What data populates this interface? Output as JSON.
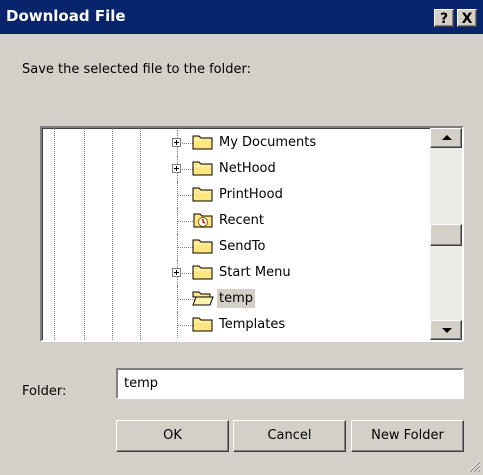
{
  "window": {
    "title": "Download File",
    "help_label": "?",
    "close_label": "X"
  },
  "instruction": "Save the selected file to the folder:",
  "tree": {
    "items": [
      {
        "label": "My Documents",
        "icon": "folder-icon",
        "expandable": true,
        "selected": false
      },
      {
        "label": "NetHood",
        "icon": "folder-icon",
        "expandable": true,
        "selected": false
      },
      {
        "label": "PrintHood",
        "icon": "folder-icon",
        "expandable": false,
        "selected": false
      },
      {
        "label": "Recent",
        "icon": "recent-folder-icon",
        "expandable": false,
        "selected": false
      },
      {
        "label": "SendTo",
        "icon": "folder-icon",
        "expandable": false,
        "selected": false
      },
      {
        "label": "Start Menu",
        "icon": "folder-icon",
        "expandable": true,
        "selected": false
      },
      {
        "label": "temp",
        "icon": "open-folder-icon",
        "expandable": false,
        "selected": true
      },
      {
        "label": "Templates",
        "icon": "folder-icon",
        "expandable": false,
        "selected": false
      }
    ]
  },
  "folder_field": {
    "label": "Folder:",
    "value": "temp"
  },
  "buttons": {
    "ok": "OK",
    "cancel": "Cancel",
    "new_folder": "New Folder"
  },
  "colors": {
    "titlebar": "#08246b",
    "face": "#d4d0c8",
    "folder": "#ffe680"
  }
}
